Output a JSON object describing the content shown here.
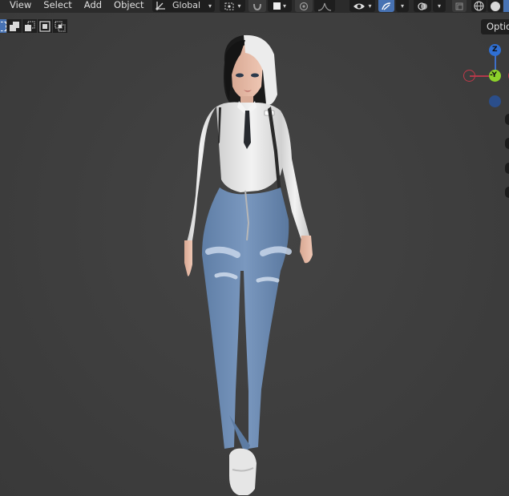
{
  "header": {
    "menus": [
      {
        "key": "view",
        "label": "View"
      },
      {
        "key": "select",
        "label": "Select"
      },
      {
        "key": "add",
        "label": "Add"
      },
      {
        "key": "object",
        "label": "Object"
      }
    ],
    "transform_orientation": "Global"
  },
  "options_label": "Optio",
  "gizmo": {
    "z_label": "Z",
    "y_label": "-Y",
    "colors": {
      "x": "#c0394a",
      "y": "#8cd22a",
      "z": "#2f6fd3"
    }
  },
  "colors": {
    "accent": "#4772b3",
    "header_bg": "#2b2b2b",
    "viewport_bg": "#3d3d3d"
  },
  "icons": {
    "orientation": "transform-orientation-icon",
    "pivot": "pivot-point-icon",
    "snap": "snap-magnet-icon",
    "snap_target": "snap-target-icon",
    "proportional": "proportional-editing-icon",
    "falloff": "falloff-curve-icon",
    "visibility": "eye-visibility-icon",
    "gizmos": "gizmo-toggle-icon",
    "overlays": "overlays-icon",
    "xray": "xray-toggle-icon",
    "wireframe_shading": "wireframe-shading-icon",
    "solid_shading": "solid-shading-icon"
  }
}
